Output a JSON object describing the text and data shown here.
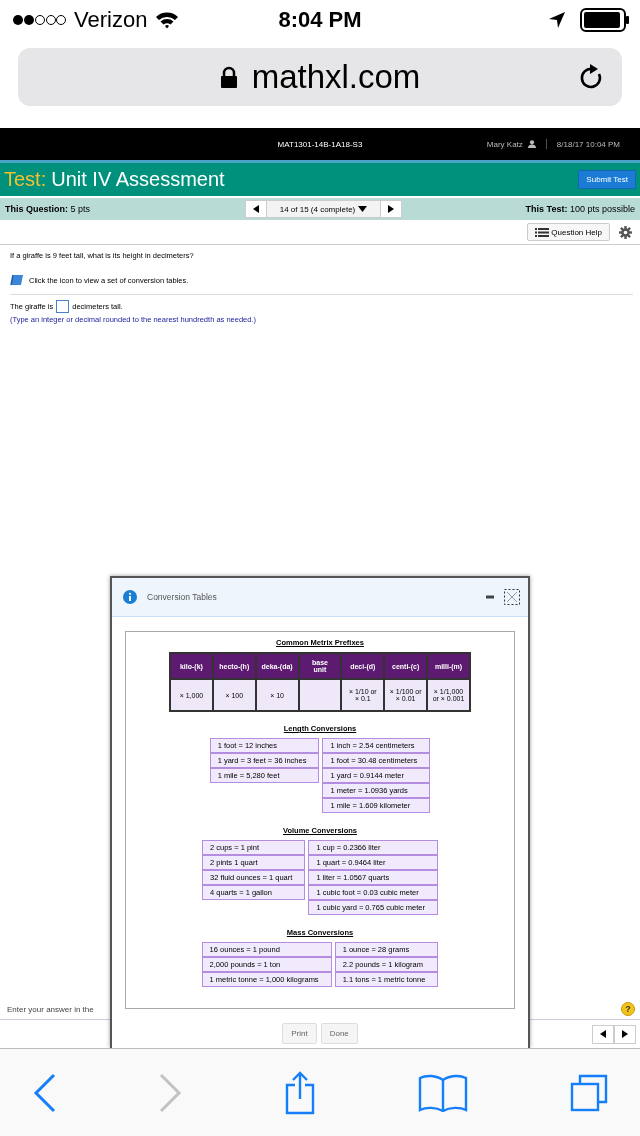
{
  "status_bar": {
    "carrier": "Verizon",
    "time": "8:04 PM"
  },
  "address_bar": {
    "url": "mathxl.com"
  },
  "course_bar": {
    "course": "MAT1301-14B-1A18-S3",
    "user": "Mary Katz",
    "datetime": "8/18/17 10:04 PM"
  },
  "test_header": {
    "label": "Test:",
    "title": "Unit IV Assessment",
    "submit": "Submit Test"
  },
  "question_bar": {
    "question_label": "This Question:",
    "question_points": "5 pts",
    "position": "14 of 15 (4 complete)",
    "test_label": "This Test:",
    "test_points": "100 pts possible"
  },
  "question_help": "Question Help",
  "question": {
    "prompt": "If a giraffe is 9 feet tall, what is its height in decimeters?",
    "tables_hint": "Click the icon to view a set of conversion tables.",
    "answer_before": "The giraffe is",
    "answer_after": "decimeters tall.",
    "instructions": "(Type an integer or decimal rounded to the nearest hundredth as needed.)"
  },
  "footer": {
    "hint": "Enter your answer in the",
    "help": "?"
  },
  "dialog": {
    "title": "Conversion Tables",
    "prefix_table": {
      "title": "Common Metrix Prefixes",
      "columns": [
        {
          "header": "kilo-(k)",
          "value": "× 1,000"
        },
        {
          "header": "hecto-(h)",
          "value": "× 100"
        },
        {
          "header": "deka-(da)",
          "value": "× 10"
        },
        {
          "header": "base unit"
        },
        {
          "header": "deci-(d)",
          "value": "× 1/10 or × 0.1"
        },
        {
          "header": "centi-(c)",
          "value": "× 1/100 or × 0.01"
        },
        {
          "header": "milli-(m)",
          "value": "× 1/1,000 or × 0.001"
        }
      ]
    },
    "sections": [
      {
        "title": "Length Conversions",
        "left": [
          "1 foot = 12 inches",
          "1 yard = 3 feet = 36 inches",
          "1 mile = 5,280 feet"
        ],
        "right": [
          "1 inch = 2.54 centimeters",
          "1 foot = 30.48 centimeters",
          "1 yard = 0.9144 meter",
          "1 meter = 1.0936 yards",
          "1 mile = 1.609 kilometer"
        ]
      },
      {
        "title": "Volume Conversions",
        "left": [
          "2 cups = 1 pint",
          "2 pints  1 quart",
          "32 fluid ounces = 1 quart",
          "4 quarts = 1 gallon"
        ],
        "right": [
          "1 cup = 0.2366 liter",
          "1 quart = 0.9464 liter",
          "1 liter = 1.0567 quarts",
          "1 cubic foot = 0.03 cubic meter",
          "1 cubic yard = 0.765 cubic meter"
        ]
      },
      {
        "title": "Mass Conversions",
        "left": [
          "16 ounces = 1 pound",
          "2,000 pounds = 1 ton",
          "1 metric tonne = 1,000 kilograms"
        ],
        "right": [
          "1 ounce = 28 grams",
          "2.2 pounds = 1 kilogram",
          "1.1 tons = 1 metric tonne"
        ]
      }
    ],
    "buttons": [
      "Print",
      "Done"
    ]
  },
  "browser_toolbar": [
    {
      "kind": "back",
      "disabled": false
    },
    {
      "kind": "forward",
      "disabled": true
    },
    {
      "kind": "share",
      "disabled": false
    },
    {
      "kind": "bookmarks",
      "disabled": false
    },
    {
      "kind": "tabs",
      "disabled": false
    }
  ]
}
